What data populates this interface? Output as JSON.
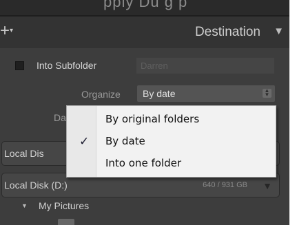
{
  "header": {
    "partial_title": "pply Du   g  p    ",
    "title": "Destination",
    "plus_icon": "+",
    "collapse_icon": "▼"
  },
  "subfolder": {
    "label": "Into Subfolder",
    "checked": false,
    "value": "Darren"
  },
  "organize": {
    "label": "Organize",
    "value": "By date",
    "options": [
      "By original folders",
      "By date",
      "Into one folder"
    ],
    "selected_index": 1
  },
  "date_format": {
    "label_partial": "Da"
  },
  "volumes": [
    {
      "name": "Local Dis",
      "size": ""
    },
    {
      "name": "Local Disk (D:)",
      "size": "640 / 931 GB"
    }
  ],
  "folders": {
    "my_pictures": "My Pictures"
  },
  "icons": {
    "check": "✓",
    "disclosure": "▼",
    "stepper": "⬍"
  },
  "colors": {
    "panel_bg": "#3d3d3d",
    "menu_bg": "#f2f2f2"
  }
}
